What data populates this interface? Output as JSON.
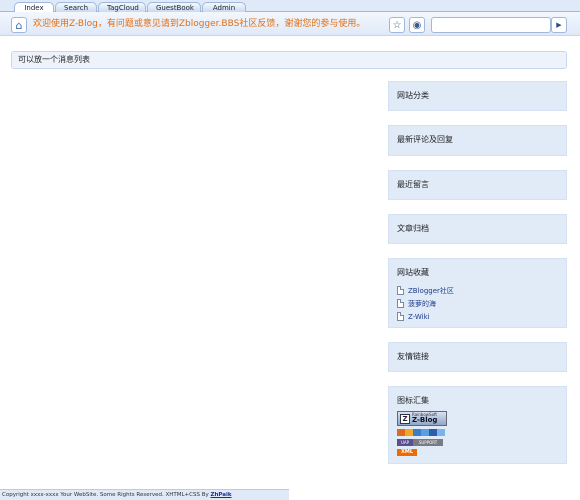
{
  "tabs": [
    {
      "label": "Index",
      "active": true
    },
    {
      "label": "Search"
    },
    {
      "label": "TagCloud"
    },
    {
      "label": "GuestBook"
    },
    {
      "label": "Admin"
    }
  ],
  "header": {
    "welcome": "欢迎使用Z-Blog，有问题或意见请到Zblogger.BBS社区反馈，谢谢您的参与使用。",
    "home_icon": "⌂",
    "star_icon": "☆",
    "rss_icon": "◉",
    "search_value": "",
    "go_icon": "▶"
  },
  "message_bar": "可以放一个消息列表",
  "sidebar": {
    "category": "网站分类",
    "comments": "最新评论及回复",
    "guestbook": "最近留言",
    "archive": "文章归档",
    "favorites": {
      "title": "网站收藏",
      "items": [
        "ZBlogger社区",
        "菠萝的海",
        "Z-Wiki"
      ]
    },
    "links": "友情链接",
    "misc": {
      "title": "图标汇集",
      "zblog_top": "RainbowSoft",
      "zblog_label": "Z-Blog",
      "support_left": "UAP",
      "support_right": "SUPPORT",
      "xml_label": "XML"
    }
  },
  "footer": {
    "text": "Copyright xxxx-xxxx Your WebSite. Some Rights Reserved. XHTML+CSS By ",
    "link": "ZhPaik"
  },
  "colors": {
    "welcome_text": "#e26e12",
    "panel_bg": "#e1ebf8",
    "border": "#9fb8dc"
  }
}
